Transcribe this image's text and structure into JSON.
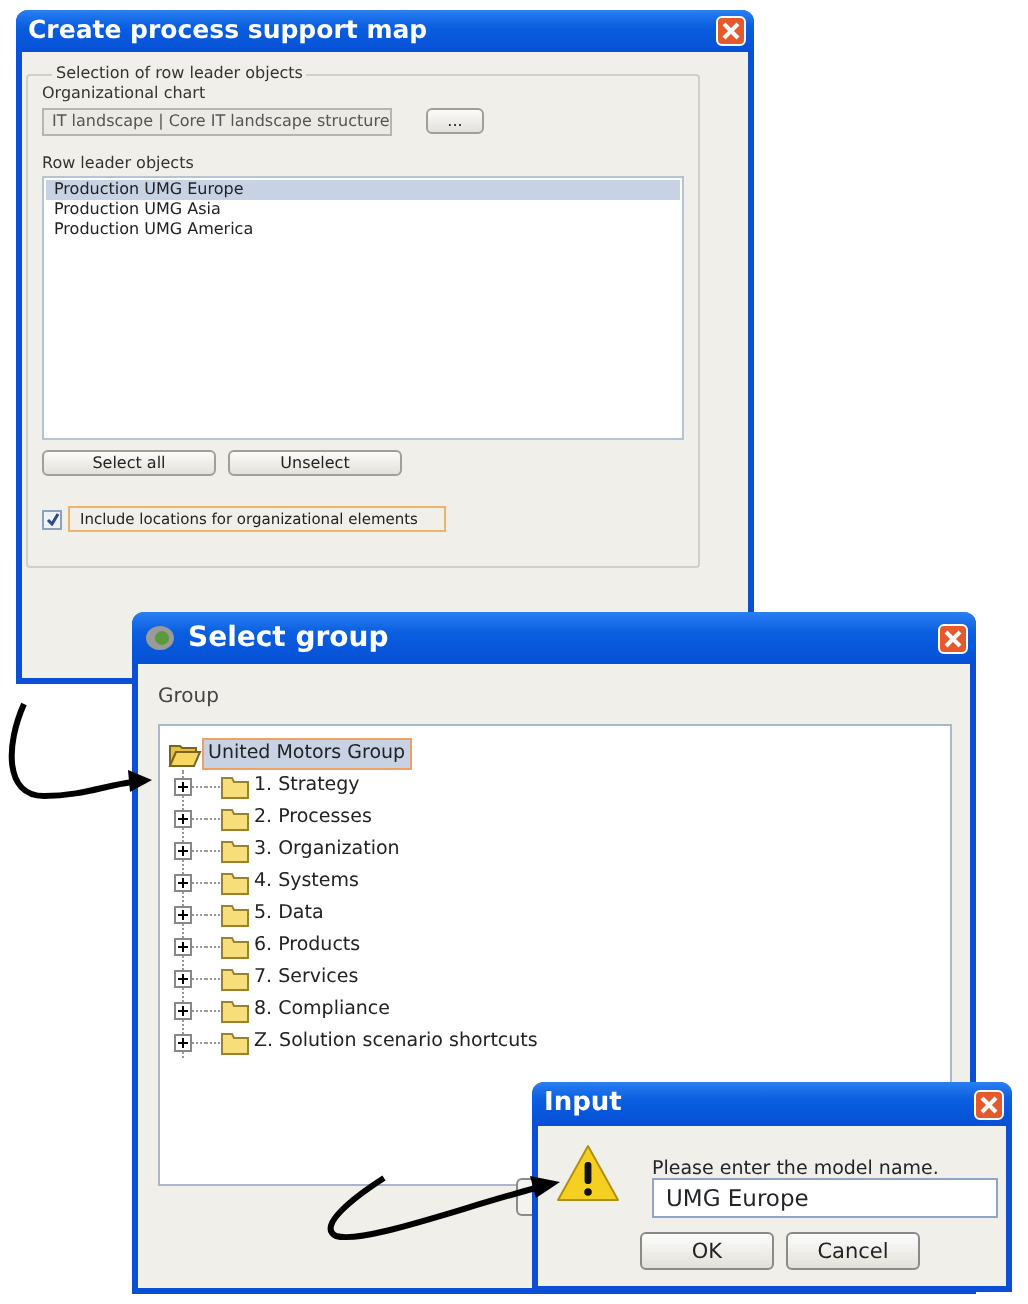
{
  "process_map_window": {
    "title": "Create process support map",
    "group_label": "Selection of row leader objects",
    "org_label": "Organizational chart",
    "org_value": "IT landscape | Core IT landscape structure",
    "browse_button": "...",
    "rows_label": "Row leader objects",
    "rows": [
      {
        "label": "Production UMG Europe",
        "selected": true
      },
      {
        "label": "Production UMG Asia",
        "selected": false
      },
      {
        "label": "Production UMG America",
        "selected": false
      }
    ],
    "buttons": [
      "Select all",
      "Unselect"
    ],
    "checkbox": {
      "label": "Include locations for organizational elements",
      "checked": true
    }
  },
  "select_group_window": {
    "title": "Select group",
    "tree_label": "Group",
    "tree": {
      "label": "United Motors Group",
      "selected": true,
      "expanded": true,
      "children": [
        {
          "label": "1. Strategy",
          "selected": false,
          "expanded": false
        },
        {
          "label": "2. Processes",
          "selected": false,
          "expanded": false
        },
        {
          "label": "3. Organization",
          "selected": false,
          "expanded": false
        },
        {
          "label": "4. Systems",
          "selected": false,
          "expanded": false
        },
        {
          "label": "5. Data",
          "selected": false,
          "expanded": false
        },
        {
          "label": "6. Products",
          "selected": false,
          "expanded": false
        },
        {
          "label": "7. Services",
          "selected": false,
          "expanded": false
        },
        {
          "label": "8. Compliance",
          "selected": false,
          "expanded": false
        },
        {
          "label": "Z. Solution scenario shortcuts",
          "selected": false,
          "expanded": false
        }
      ]
    }
  },
  "input_window": {
    "title": "Input",
    "prompt": "Please enter the model name.",
    "value": "UMG Europe",
    "buttons": [
      "OK",
      "Cancel"
    ]
  }
}
